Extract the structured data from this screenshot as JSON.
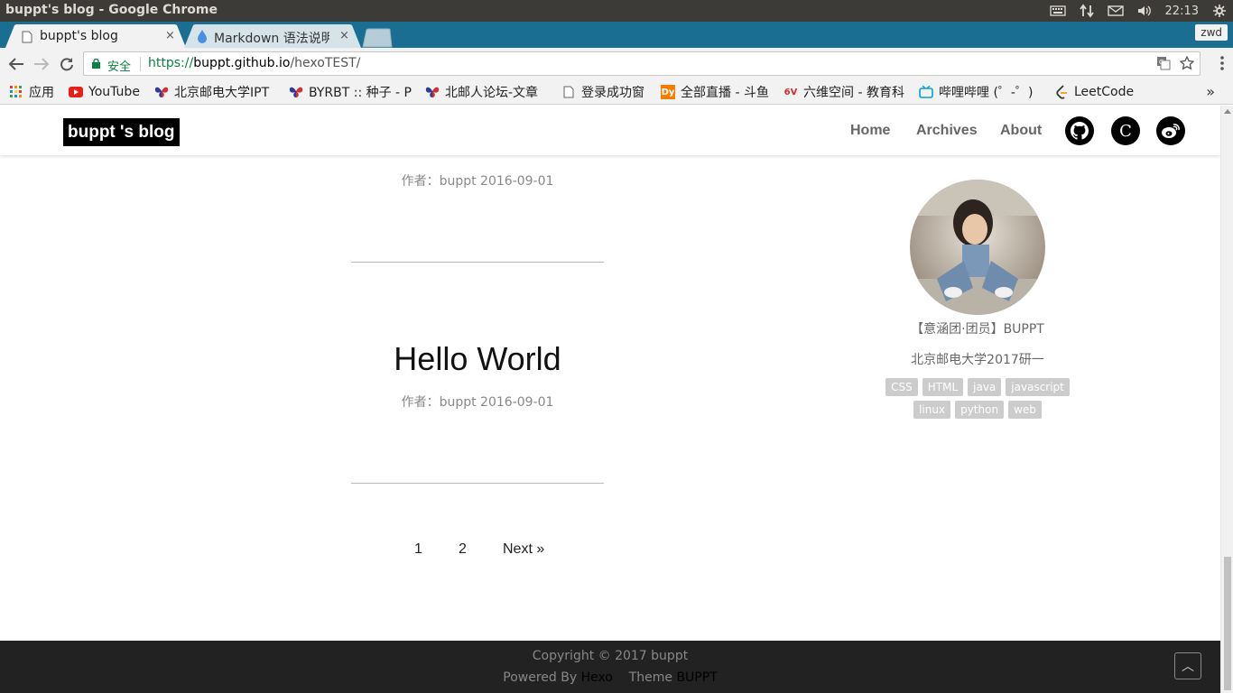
{
  "os": {
    "window_title": "buppt's blog - Google Chrome",
    "clock": "22:13"
  },
  "tabs": [
    {
      "label": "buppt's blog",
      "close": "×"
    },
    {
      "label": "Markdown 语法说明",
      "close": "×"
    }
  ],
  "profile": "zwd",
  "omnibox": {
    "secure_label": "安全",
    "url_scheme": "https://",
    "url_host": "buppt.github.io",
    "url_path": "/hexoTEST/"
  },
  "bookmarks": [
    {
      "label": "应用",
      "icon": "apps-grid-icon"
    },
    {
      "label": "YouTube",
      "icon": "youtube-icon"
    },
    {
      "label": "北京邮电大学IPT",
      "icon": "byr-butterfly-icon"
    },
    {
      "label": "BYRBT :: 种子 - P",
      "icon": "byr-butterfly-icon"
    },
    {
      "label": "北邮人论坛-文章",
      "icon": "byr-butterfly-icon"
    },
    {
      "label": "登录成功窗",
      "icon": "page-icon"
    },
    {
      "label": "全部直播 - 斗鱼",
      "icon": "douyu-icon"
    },
    {
      "label": "六维空间 - 教育科",
      "icon": "6v-icon"
    },
    {
      "label": "哔哩哔哩 (゜-゜)",
      "icon": "bilibili-icon"
    },
    {
      "label": "LeetCode",
      "icon": "leetcode-icon"
    }
  ],
  "bookmarks_more": "»",
  "site": {
    "logo": "buppt 's blog",
    "nav": [
      "Home",
      "Archives",
      "About"
    ],
    "social": {
      "github": "github-icon",
      "c_label": "C",
      "weibo": "weibo-icon"
    }
  },
  "posts": [
    {
      "title": "",
      "meta": "作者：buppt 2016-09-01"
    },
    {
      "title": "Hello World",
      "meta": "作者：buppt 2016-09-01"
    }
  ],
  "pagination": {
    "pages": [
      "1",
      "2"
    ],
    "next": "Next »"
  },
  "sidebar": {
    "name": "【意涵团·团员】BUPPT",
    "bio": "北京邮电大学2017研一",
    "tags": [
      "CSS",
      "HTML",
      "java",
      "javascript",
      "linux",
      "python",
      "web"
    ]
  },
  "footer": {
    "copyright": "Copyright © 2017 buppt",
    "powered_prefix": "Powered By ",
    "powered_link": "Hexo",
    "theme_prefix": "Theme ",
    "theme_link": "BUPPT",
    "to_top": "︿"
  },
  "colors": {
    "tabstrip": "#1a6e92",
    "secure_green": "#0b8043",
    "footer_bg": "#222222",
    "tag_bg": "#cccccc"
  }
}
